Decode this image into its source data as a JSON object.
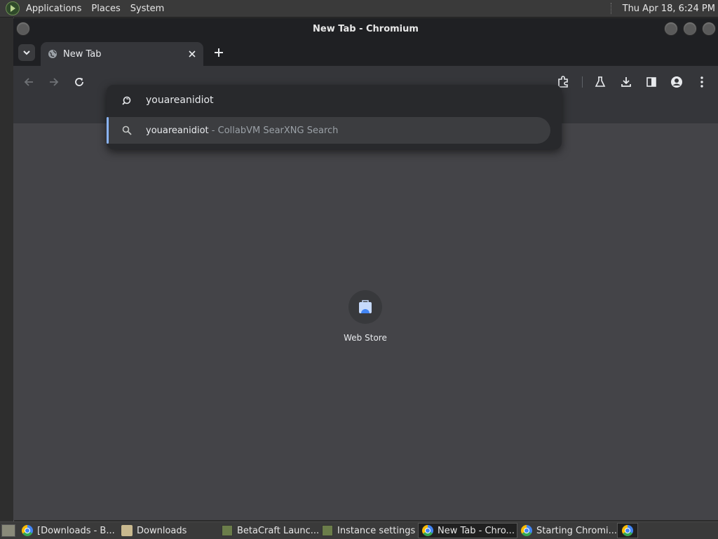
{
  "top_panel": {
    "menus": [
      "Applications",
      "Places",
      "System"
    ],
    "clock": "Thu Apr 18,  6:24 PM"
  },
  "window": {
    "title": "New Tab - Chromium"
  },
  "tabs": {
    "active_title": "New Tab"
  },
  "omnibox": {
    "value": "youareanidiot",
    "suggestion_query": "youareanidiot",
    "suggestion_description": " - CollabVM SearXNG Search"
  },
  "new_tab_page": {
    "shortcut_label": "Web Store"
  },
  "taskbar": {
    "items": [
      {
        "label": "[Downloads - B...",
        "icon": "chrome-icon"
      },
      {
        "label": "Downloads",
        "icon": "folder-icon"
      },
      {
        "label": "BetaCraft Launc...",
        "icon": "minecraft-icon"
      },
      {
        "label": "Instance settings",
        "icon": "minecraft-icon"
      },
      {
        "label": "New Tab - Chro...",
        "icon": "chrome-icon"
      },
      {
        "label": "Starting Chromi...",
        "icon": "chrome-icon"
      }
    ]
  },
  "colors": {
    "accent": "#8ab4f8",
    "toolbar": "#35363a",
    "content_bg": "#444448"
  }
}
